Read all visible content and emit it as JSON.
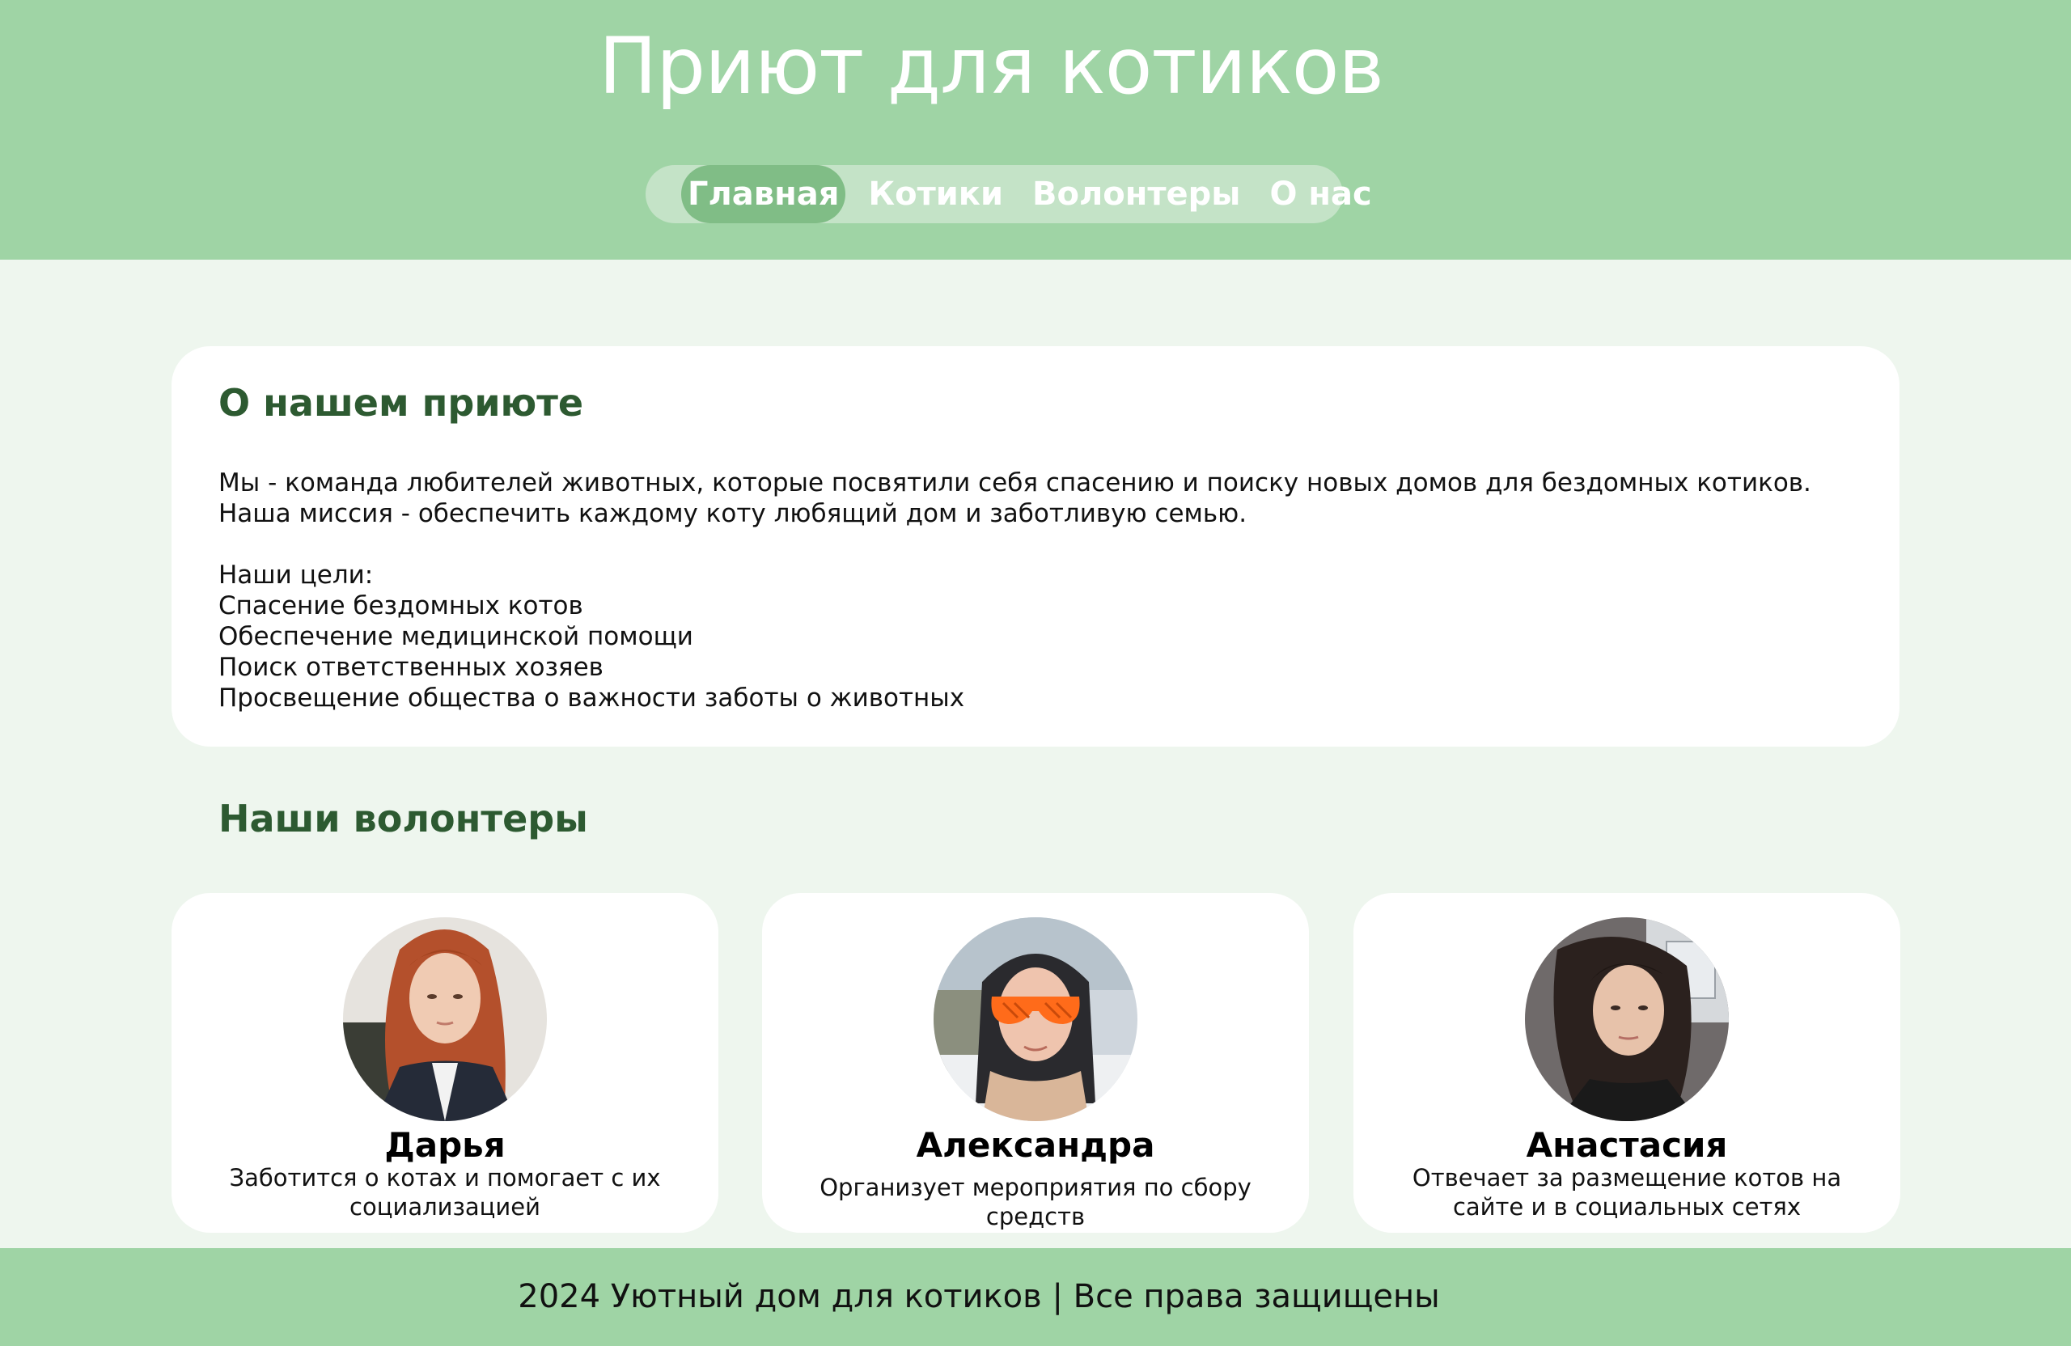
{
  "header": {
    "title": "Приют для котиков",
    "nav": [
      {
        "label": "Главная",
        "active": true
      },
      {
        "label": "Котики",
        "active": false
      },
      {
        "label": "Волонтеры",
        "active": false
      },
      {
        "label": "О нас",
        "active": false
      }
    ]
  },
  "about": {
    "title": "О нашем приюте",
    "intro": [
      "Мы - команда любителей животных, которые посвятили себя спасению и поиску новых домов для бездомных котиков.",
      "Наша миссия - обеспечить каждому коту любящий дом и заботливую семью."
    ],
    "goals_heading": "Наши цели:",
    "goals": [
      "Спасение бездомных котов",
      "Обеспечение медицинской помощи",
      "Поиск ответственных хозяев",
      "Просвещение общества о важности заботы о животных"
    ]
  },
  "volunteers": {
    "title": "Наши волонтеры",
    "items": [
      {
        "name": "Дарья",
        "description": "Заботится о котах и помогает с их социализацией"
      },
      {
        "name": "Александра",
        "description": "Организует мероприятия по сбору средств"
      },
      {
        "name": "Анастасия",
        "description": "Отвечает за размещение котов на сайте и в социальных сетях"
      }
    ]
  },
  "footer": {
    "text": "2024 Уютный дом для котиков | Все права защищены"
  },
  "colors": {
    "header_bg": "#9fd4a5",
    "page_bg": "#eef6ee",
    "heading_green": "#2d5a31",
    "nav_active_bg": "#80bd86",
    "nav_bg": "#c4e3c7"
  }
}
